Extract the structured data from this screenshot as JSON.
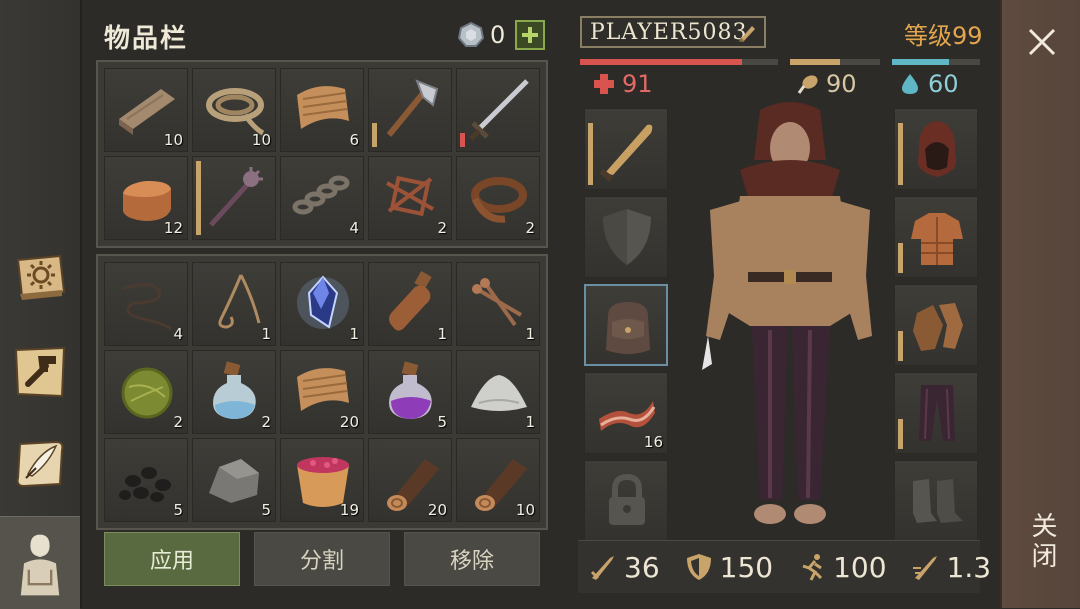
{
  "inventory": {
    "title": "物品栏",
    "coins": "0",
    "slots": [
      {
        "name": "plank",
        "qty": "10"
      },
      {
        "name": "rope",
        "qty": "10"
      },
      {
        "name": "cloth",
        "qty": "6"
      },
      {
        "name": "axe",
        "qty": ""
      },
      {
        "name": "sword",
        "qty": ""
      },
      {
        "name": "copper-ingot",
        "qty": "12"
      },
      {
        "name": "mace",
        "qty": ""
      },
      {
        "name": "chain",
        "qty": "4"
      },
      {
        "name": "scrap-metal",
        "qty": "2"
      },
      {
        "name": "leather-strap",
        "qty": "2"
      },
      {
        "name": "thread",
        "qty": "4"
      },
      {
        "name": "fishing-line",
        "qty": "1"
      },
      {
        "name": "magic-crystal",
        "qty": "1"
      },
      {
        "name": "bottle",
        "qty": "1"
      },
      {
        "name": "nails",
        "qty": "1"
      },
      {
        "name": "herb-bundle",
        "qty": "2"
      },
      {
        "name": "water-potion",
        "qty": "2"
      },
      {
        "name": "cloth",
        "qty": "20"
      },
      {
        "name": "purple-potion",
        "qty": "5"
      },
      {
        "name": "salt",
        "qty": "1"
      },
      {
        "name": "coal",
        "qty": "5"
      },
      {
        "name": "stone",
        "qty": "5"
      },
      {
        "name": "berry-bowl",
        "qty": "19"
      },
      {
        "name": "log",
        "qty": "20"
      },
      {
        "name": "log",
        "qty": "10"
      }
    ],
    "buttons": {
      "apply": "应用",
      "split": "分割",
      "remove": "移除"
    }
  },
  "player": {
    "name": "PLAYER5083",
    "level": "等级99",
    "health": "91",
    "food": "90",
    "water": "60",
    "health_pct": 0.82,
    "food_pct": 0.55,
    "water_pct": 0.65
  },
  "equipment": {
    "weapon_qty": "",
    "bacon_qty": "16"
  },
  "stats": {
    "attack": "36",
    "defense": "150",
    "speed": "100",
    "attack_speed": "1.3"
  },
  "close_label": "关闭",
  "colors": {
    "health": "#d9534f",
    "food": "#c9a46a",
    "water": "#5fb6c4",
    "level": "#e3a64e",
    "apply_button": "#5a6a40"
  }
}
